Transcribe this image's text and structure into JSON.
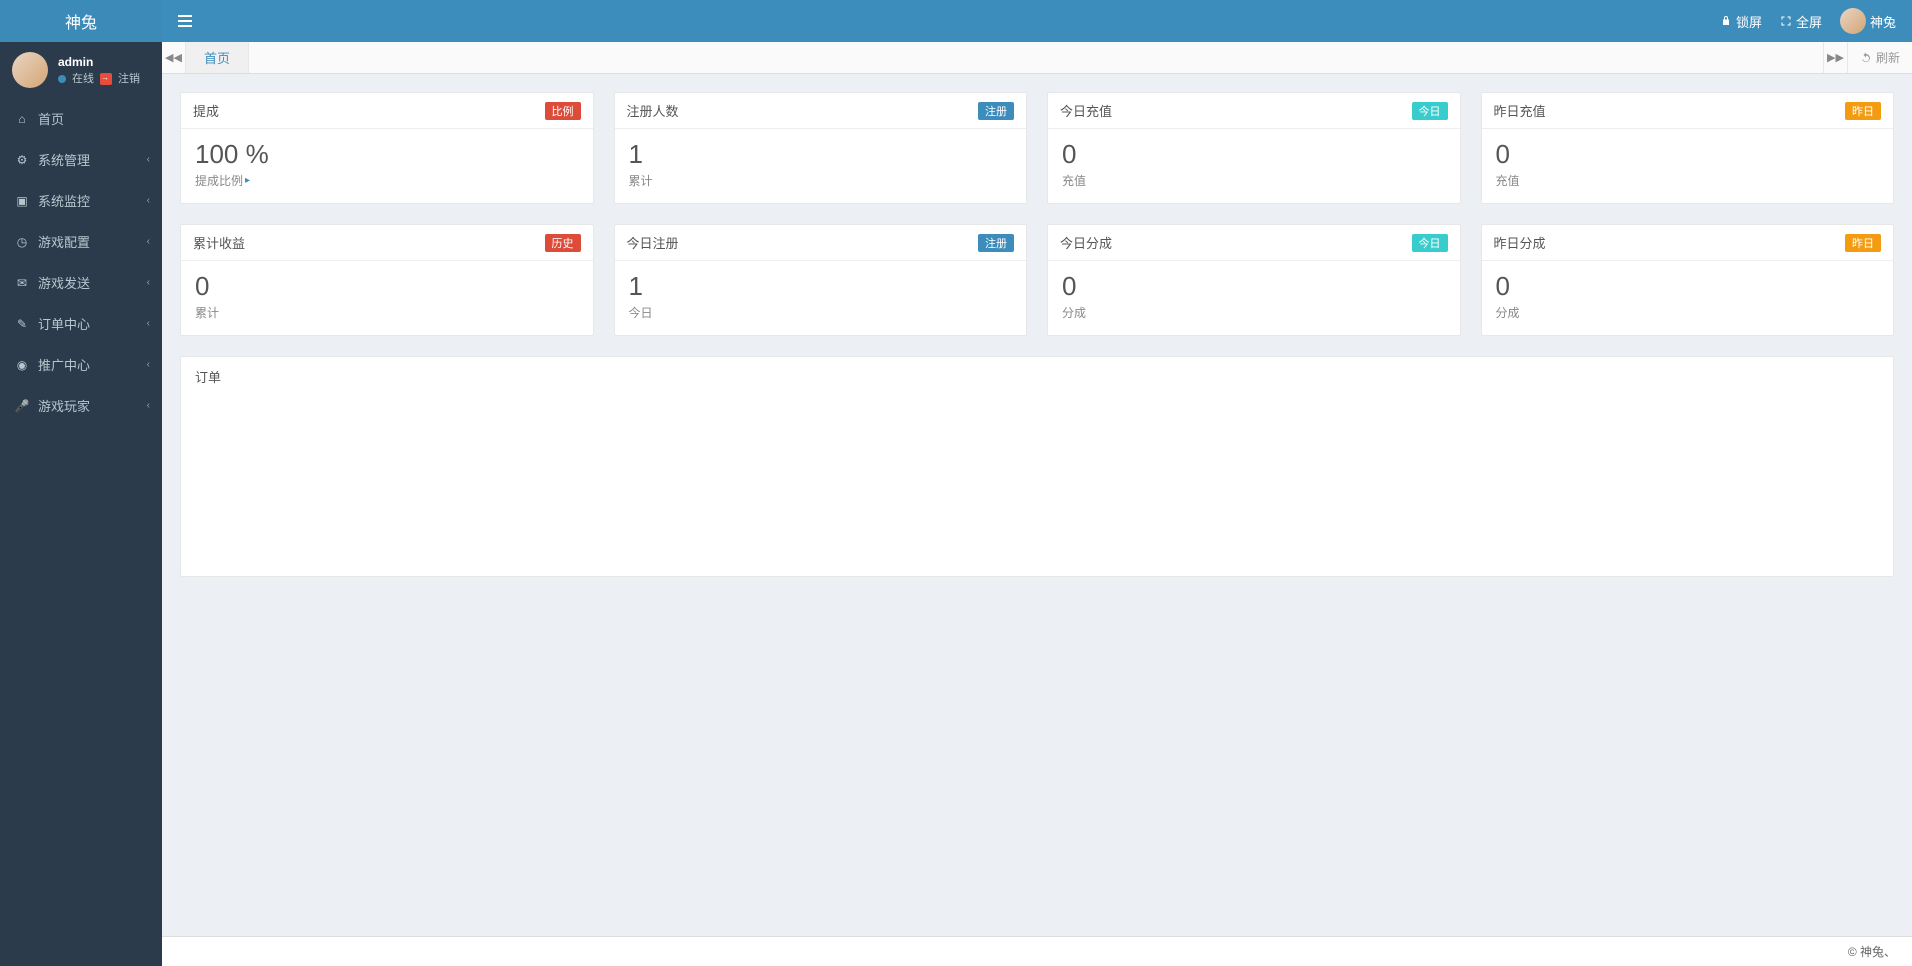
{
  "brand": "神兔",
  "user": {
    "name": "admin",
    "online": "在线",
    "logout": "注销"
  },
  "nav": {
    "home": "首页",
    "system_manage": "系统管理",
    "system_monitor": "系统监控",
    "game_config": "游戏配置",
    "game_send": "游戏发送",
    "order_center": "订单中心",
    "promo_center": "推广中心",
    "game_player": "游戏玩家"
  },
  "topbar": {
    "lock": "锁屏",
    "fullscreen": "全屏",
    "username": "神兔"
  },
  "tabs": {
    "active": "首页",
    "refresh": "刷新"
  },
  "cards": {
    "row1": [
      {
        "title": "提成",
        "badge": "比例",
        "badgeClass": "bg-red",
        "value": "100 %",
        "sub": "提成比例"
      },
      {
        "title": "注册人数",
        "badge": "注册",
        "badgeClass": "bg-blue",
        "value": "1",
        "sub": "累计"
      },
      {
        "title": "今日充值",
        "badge": "今日",
        "badgeClass": "bg-teal",
        "value": "0",
        "sub": "充值"
      },
      {
        "title": "昨日充值",
        "badge": "昨日",
        "badgeClass": "bg-orange",
        "value": "0",
        "sub": "充值"
      }
    ],
    "row2": [
      {
        "title": "累计收益",
        "badge": "历史",
        "badgeClass": "bg-red",
        "value": "0",
        "sub": "累计"
      },
      {
        "title": "今日注册",
        "badge": "注册",
        "badgeClass": "bg-blue",
        "value": "1",
        "sub": "今日"
      },
      {
        "title": "今日分成",
        "badge": "今日",
        "badgeClass": "bg-teal",
        "value": "0",
        "sub": "分成"
      },
      {
        "title": "昨日分成",
        "badge": "昨日",
        "badgeClass": "bg-orange",
        "value": "0",
        "sub": "分成"
      }
    ]
  },
  "order_panel": {
    "title": "订单"
  },
  "footer": "© 神兔、"
}
